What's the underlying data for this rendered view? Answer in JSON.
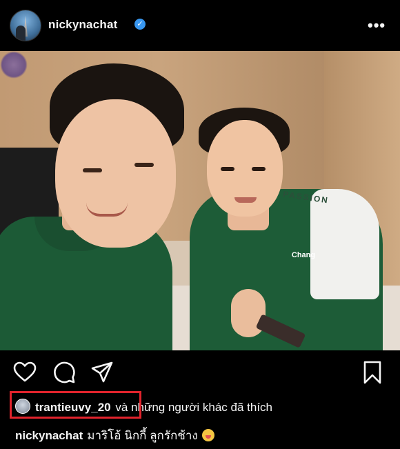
{
  "post": {
    "username": "nickynachat",
    "verified_mark": "✓",
    "more_label": "•••"
  },
  "photo": {
    "shirt_text_passion": "PASSION",
    "shirt_logo": "Chang"
  },
  "likes": {
    "first_liker": "trantieuvy_20",
    "rest_text": "và những người khác đã thích"
  },
  "caption": {
    "username": "nickynachat",
    "text": "มาริโอ้ นิกกี้ ลูกรักช้าง"
  },
  "colors": {
    "verified": "#3897f0",
    "highlight_box": "#e2232c"
  },
  "icons": [
    "heart-icon",
    "comment-icon",
    "share-icon",
    "bookmark-icon",
    "more-icon",
    "emoji-icon"
  ]
}
